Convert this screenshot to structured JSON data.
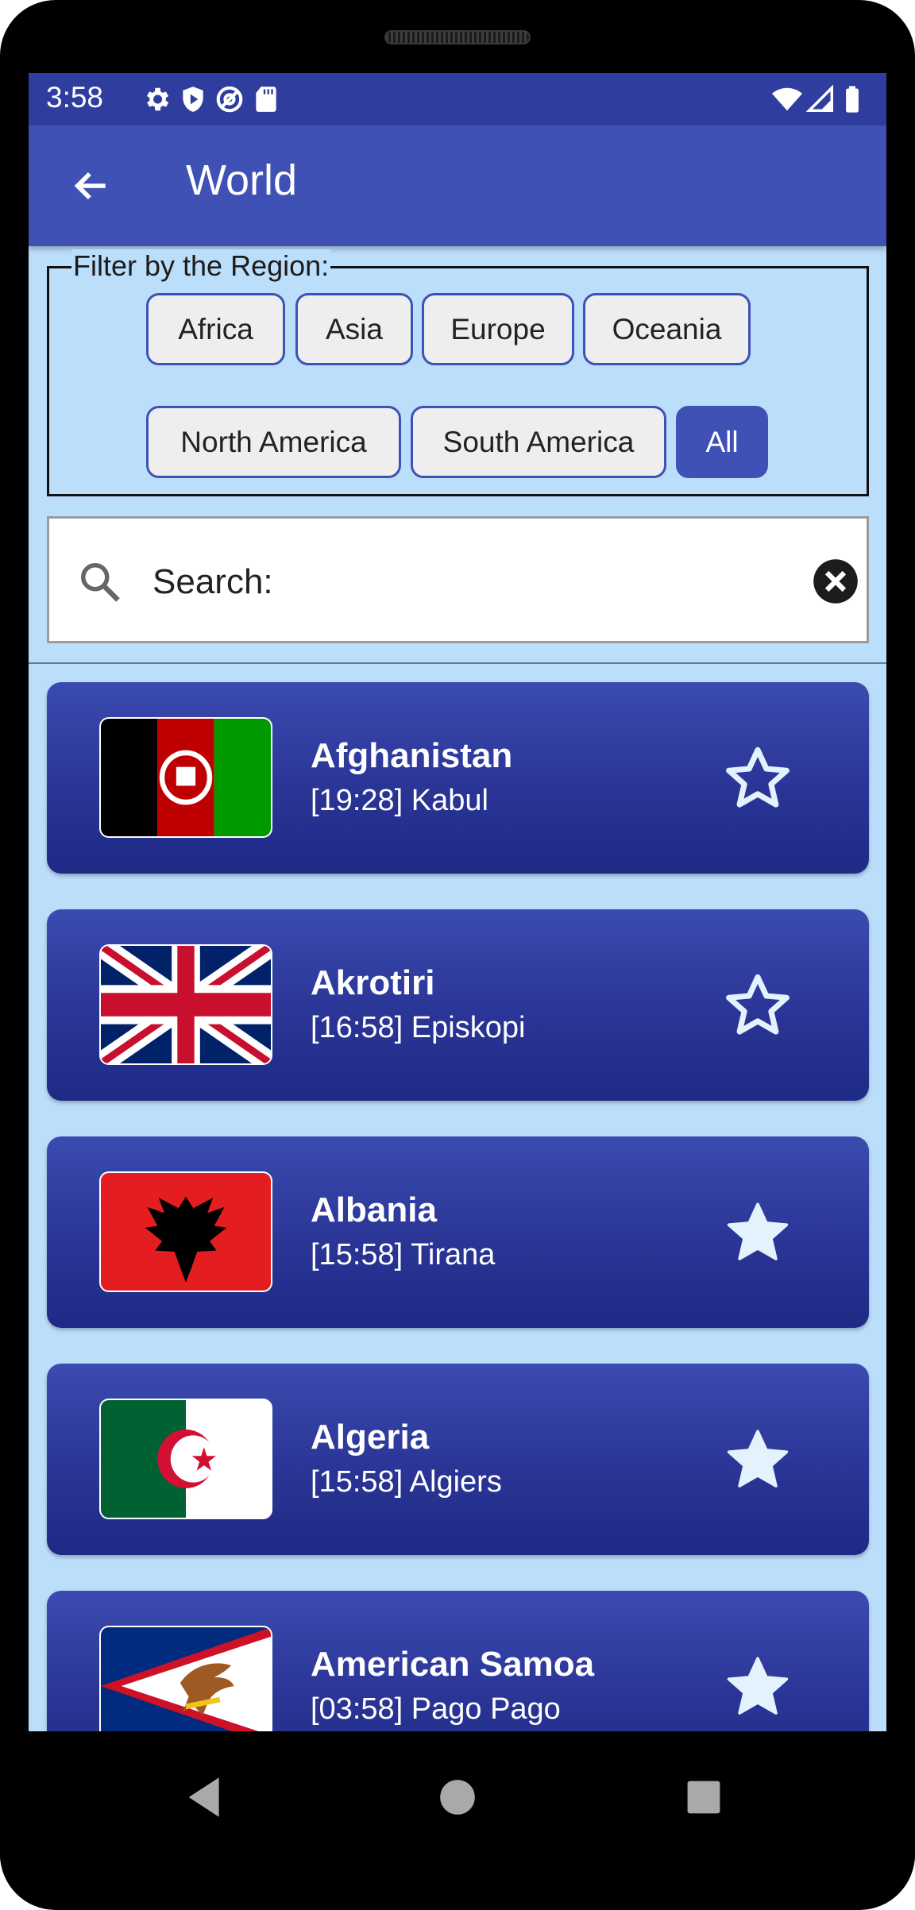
{
  "status": {
    "time": "3:58",
    "icons": [
      "gear-icon",
      "shield-play-icon",
      "at-sign-icon",
      "sd-card-icon",
      "wifi-icon",
      "signal-icon",
      "battery-icon"
    ]
  },
  "appbar": {
    "title": "World",
    "back_icon": "arrow-left-icon"
  },
  "filter": {
    "legend": "Filter by the Region:",
    "chips": [
      {
        "label": "Africa",
        "selected": false
      },
      {
        "label": "Asia",
        "selected": false
      },
      {
        "label": "Europe",
        "selected": false
      },
      {
        "label": "Oceania",
        "selected": false
      },
      {
        "label": "North America",
        "selected": false
      },
      {
        "label": "South America",
        "selected": false
      },
      {
        "label": "All",
        "selected": true
      }
    ]
  },
  "search": {
    "placeholder": "Search:",
    "value": ""
  },
  "countries": [
    {
      "name": "Afghanistan",
      "time": "[19:28] Kabul",
      "flag": "flag-afghanistan",
      "favorite": false
    },
    {
      "name": "Akrotiri",
      "time": "[16:58] Episkopi",
      "flag": "flag-united-kingdom",
      "favorite": false
    },
    {
      "name": "Albania",
      "time": "[15:58] Tirana",
      "flag": "flag-albania",
      "favorite": true
    },
    {
      "name": "Algeria",
      "time": "[15:58] Algiers",
      "flag": "flag-algeria",
      "favorite": true
    },
    {
      "name": "American Samoa",
      "time": "[03:58] Pago Pago",
      "flag": "flag-american-samoa",
      "favorite": true
    }
  ],
  "colors": {
    "primary": "#3f51b5",
    "status_bar": "#2f3e9e",
    "background": "#bbdefb",
    "card_top": "#3b4bb0",
    "card_bottom": "#1e2a85"
  }
}
